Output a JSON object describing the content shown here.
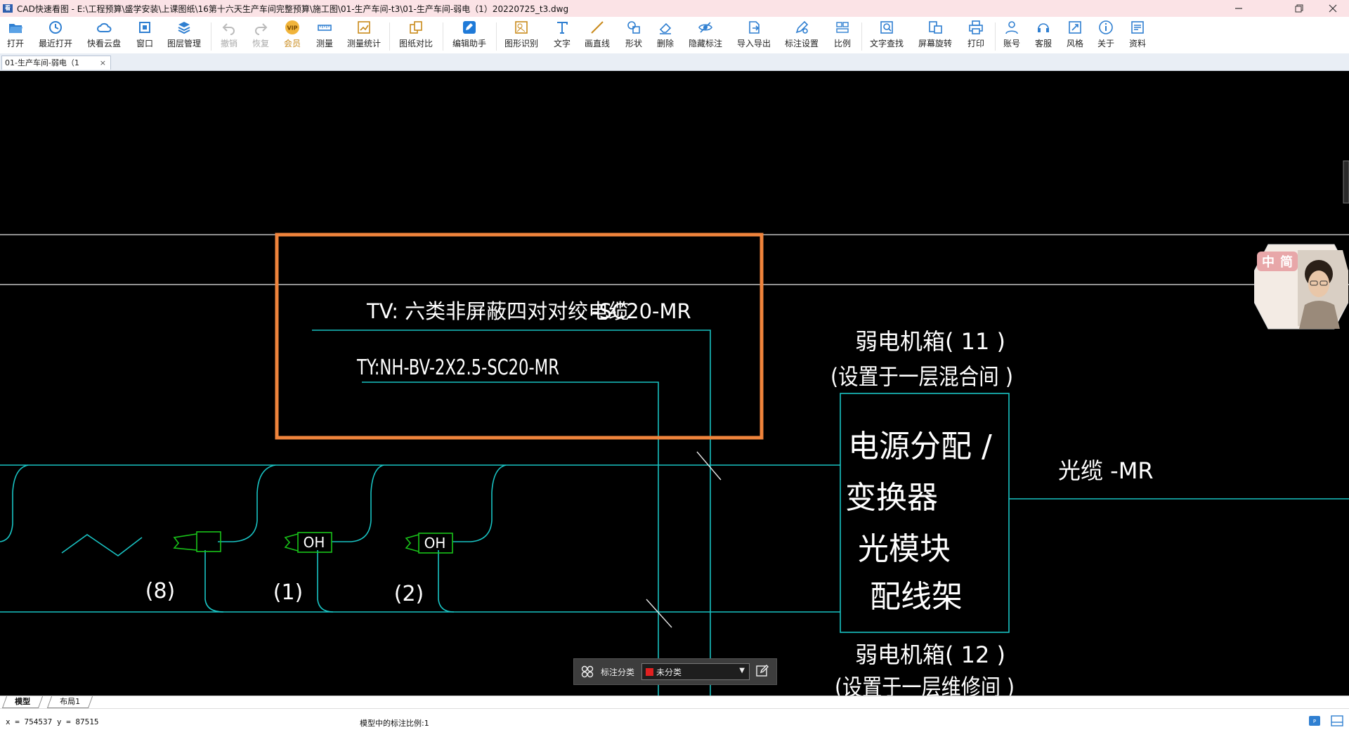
{
  "window": {
    "title": "CAD快速看图 - E:\\工程预算\\盛学安装\\上课图纸\\16第十六天生产车间完整预算\\施工图\\01-生产车间-t3\\01-生产车间-弱电（1）20220725_t3.dwg",
    "app_logo": "看"
  },
  "toolbar": {
    "items": [
      {
        "label": "打开",
        "icon": "folder-open-icon"
      },
      {
        "label": "最近打开",
        "icon": "history-icon"
      },
      {
        "label": "快看云盘",
        "icon": "cloud-icon"
      },
      {
        "label": "窗口",
        "icon": "window-icon"
      },
      {
        "label": "图层管理",
        "icon": "layers-icon"
      },
      {
        "label": "撤销",
        "icon": "undo-icon"
      },
      {
        "label": "恢复",
        "icon": "redo-icon"
      },
      {
        "label": "会员",
        "icon": "vip-icon"
      },
      {
        "label": "测量",
        "icon": "ruler-icon"
      },
      {
        "label": "测量统计",
        "icon": "measure-stats-icon"
      },
      {
        "label": "图纸对比",
        "icon": "compare-icon"
      },
      {
        "label": "编辑助手",
        "icon": "edit-assistant-icon"
      },
      {
        "label": "图形识别",
        "icon": "shape-recognize-icon"
      },
      {
        "label": "文字",
        "icon": "text-icon"
      },
      {
        "label": "画直线",
        "icon": "line-icon"
      },
      {
        "label": "形状",
        "icon": "shape-icon"
      },
      {
        "label": "删除",
        "icon": "eraser-icon"
      },
      {
        "label": "隐藏标注",
        "icon": "eye-hide-icon"
      },
      {
        "label": "导入导出",
        "icon": "import-export-icon"
      },
      {
        "label": "标注设置",
        "icon": "annotation-settings-icon"
      },
      {
        "label": "比例",
        "icon": "scale-icon"
      },
      {
        "label": "文字查找",
        "icon": "text-search-icon"
      },
      {
        "label": "屏幕旋转",
        "icon": "rotate-screen-icon"
      },
      {
        "label": "打印",
        "icon": "print-icon"
      },
      {
        "label": "账号",
        "icon": "user-icon"
      },
      {
        "label": "客服",
        "icon": "headset-icon"
      },
      {
        "label": "风格",
        "icon": "style-icon"
      },
      {
        "label": "关于",
        "icon": "info-icon"
      },
      {
        "label": "资料",
        "icon": "docs-icon"
      }
    ],
    "vip_badge": "VIP"
  },
  "tabs": {
    "active": "01-生产车间-弱电（1",
    "close": "×"
  },
  "drawing": {
    "label_tv": "TV:  六类非屏蔽四对对绞电缆",
    "label_tv_suffix": "-SC20-MR",
    "label_ty": "TY:NH-BV-2X2.5-SC20-MR",
    "box11_line1": "弱电机箱(    11  )",
    "box11_line2": "(设置于一层混合间     )",
    "panel_line1": "电源分配   /",
    "panel_line2": "变换器",
    "panel_line3": "光模块",
    "panel_line4": "配线架",
    "fiber_label": "光缆 -MR",
    "box12_line1": "弱电机箱(    12  )",
    "box12_line2": "(设置于一层维修间     )",
    "counts": [
      "(8)",
      "(1)",
      "(2)"
    ],
    "outlet_label": "OH",
    "highlight_color": "#f0843c",
    "wire_color": "#19c3c3",
    "device_color": "#19c419"
  },
  "annotation_bar": {
    "label": "标注分类",
    "selected": "未分类",
    "swatch_color": "#e02020",
    "grid_icon": "grid-icon",
    "edit_icon": "edit-icon"
  },
  "layout_tabs": [
    "模型",
    "布局1"
  ],
  "status": {
    "coords": "x = 754537  y = 87515",
    "scale": "模型中的标注比例:1"
  },
  "avatar": {
    "char1": "中",
    "char2": "简"
  },
  "colors": {
    "titlebar_bg": "#fbe3e6",
    "accent_blue": "#2f7fd1"
  }
}
